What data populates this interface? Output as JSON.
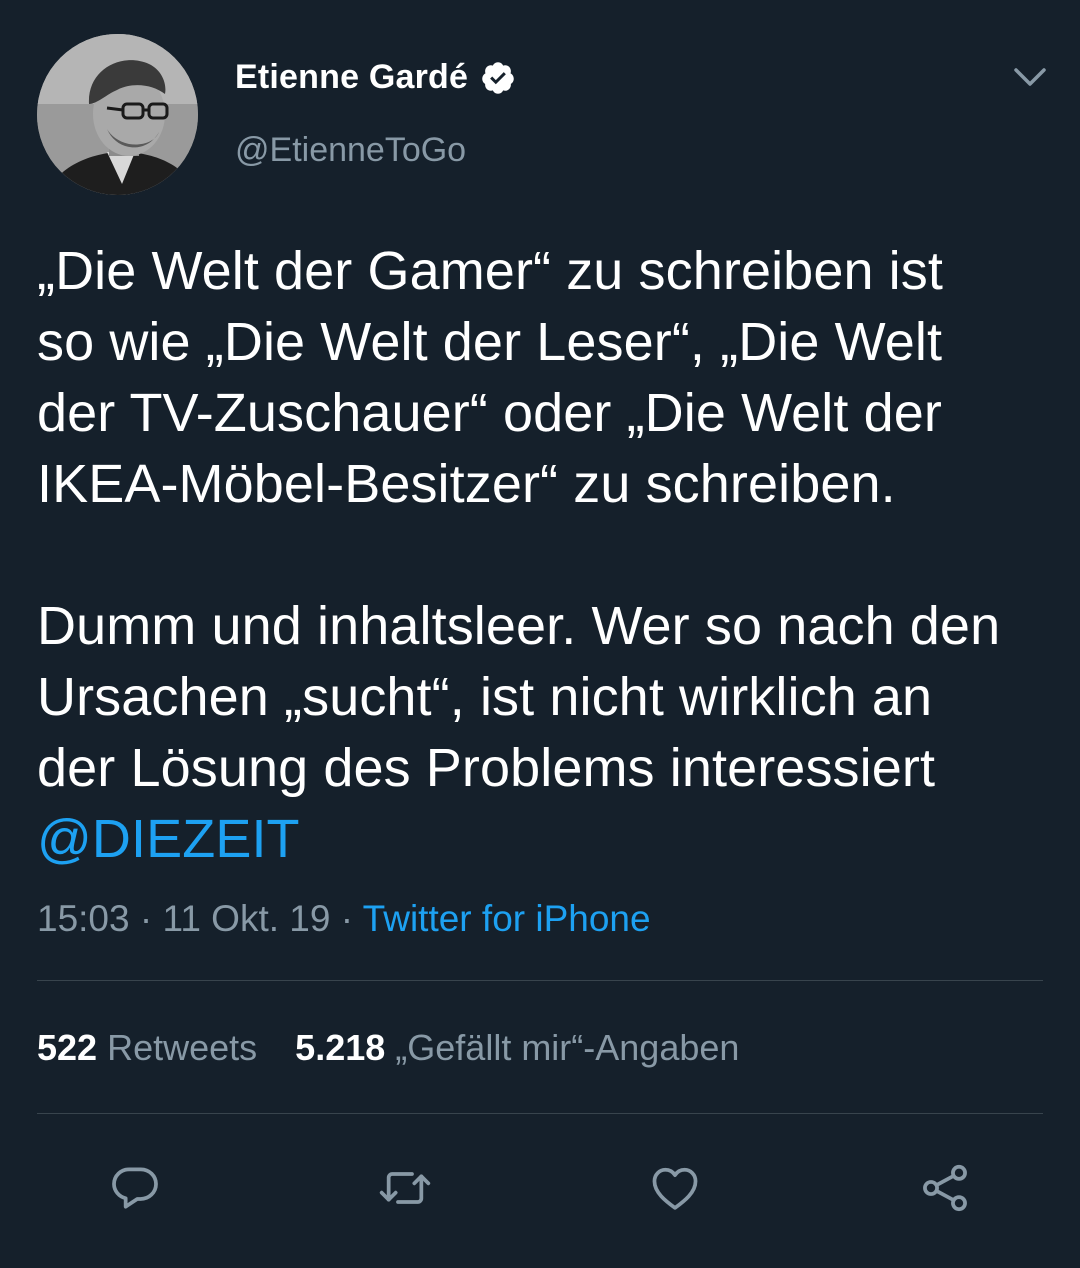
{
  "tweet": {
    "author": {
      "display_name": "Etienne Gardé",
      "handle": "@EtienneToGo",
      "verified": true
    },
    "text_lines": [
      "„Die Welt der Gamer“ zu schreiben ist",
      "so wie „Die Welt der Leser“, „Die Welt",
      "der TV-Zuschauer“ oder „Die Welt der",
      "IKEA-Möbel-Besitzer“ zu schreiben.",
      "",
      "Dumm und inhaltsleer. Wer so nach den",
      "Ursachen „sucht“, ist nicht wirklich an",
      "der Lösung des Problems interessiert"
    ],
    "mention": "@DIEZEIT",
    "time": "15:03",
    "date": "11 Okt. 19",
    "source": "Twitter for iPhone",
    "retweets_count": "522",
    "retweets_label": "Retweets",
    "likes_count": "5.218",
    "likes_label": "„Gefällt mir“-Angaben"
  },
  "icons": {
    "verified": "verified-badge-icon",
    "menu": "chevron-down-icon",
    "reply": "reply-icon",
    "retweet": "retweet-icon",
    "like": "heart-icon",
    "share": "share-icon"
  },
  "colors": {
    "background": "#15202b",
    "primary_text": "#ffffff",
    "secondary_text": "#8899a6",
    "accent": "#1da1f2",
    "divider": "#38444d"
  }
}
